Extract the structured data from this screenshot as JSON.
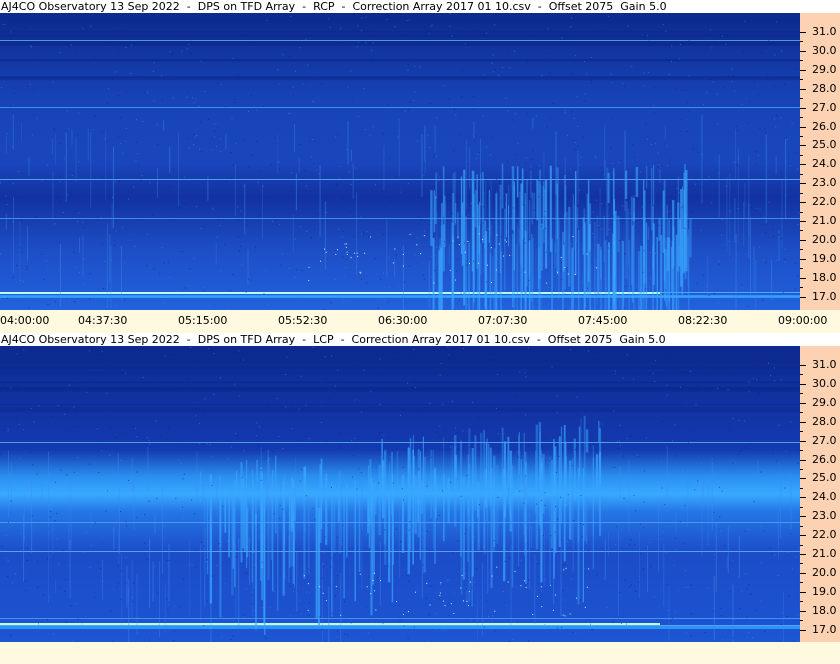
{
  "chart_data": [
    {
      "type": "heatmap",
      "title": "AJ4CO Observatory 13 Sep 2022  -  DPS on TFD Array  -  RCP  -  Correction Array 2017 01 10.csv  -  Offset 2075  Gain 5.0",
      "x_tick_labels": [
        "04:00:00",
        "04:37:30",
        "05:15:00",
        "05:52:30",
        "06:30:00",
        "07:07:30",
        "07:45:00",
        "08:22:30",
        "09:00:00"
      ],
      "y_tick_labels": [
        "31.0",
        "30.0",
        "29.0",
        "28.0",
        "27.0",
        "26.0",
        "25.0",
        "24.0",
        "23.0",
        "22.0",
        "21.0",
        "20.0",
        "19.0",
        "18.0",
        "17.0"
      ],
      "colors": {
        "background": "#1e48c8",
        "dark_band": "#0c2a90",
        "bright": "#39a7ff",
        "hot": "#b8ffe8"
      }
    },
    {
      "type": "heatmap",
      "title": "AJ4CO Observatory 13 Sep 2022  -  DPS on TFD Array  -  LCP  -  Correction Array 2017 01 10.csv  -  Offset 2075  Gain 5.0",
      "x_tick_labels": [],
      "y_tick_labels": [
        "31.0",
        "30.0",
        "29.0",
        "28.0",
        "27.0",
        "26.0",
        "25.0",
        "24.0",
        "23.0",
        "22.0",
        "21.0",
        "20.0",
        "19.0",
        "18.0",
        "17.0"
      ],
      "colors": {
        "background": "#1e48c8",
        "dark_band": "#0c2a90",
        "bright": "#39a7ff",
        "hot": "#b8ffe8"
      }
    }
  ]
}
